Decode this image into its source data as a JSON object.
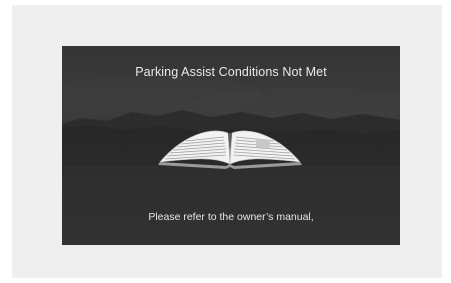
{
  "screen": {
    "title": "Parking Assist Conditions Not Met",
    "message": "Please refer to the owner’s manual,",
    "illustration": "open-book-icon"
  },
  "colors": {
    "screen_background": "#2f2f2f",
    "frame_background": "#efefef",
    "text": "#eaeaea"
  }
}
